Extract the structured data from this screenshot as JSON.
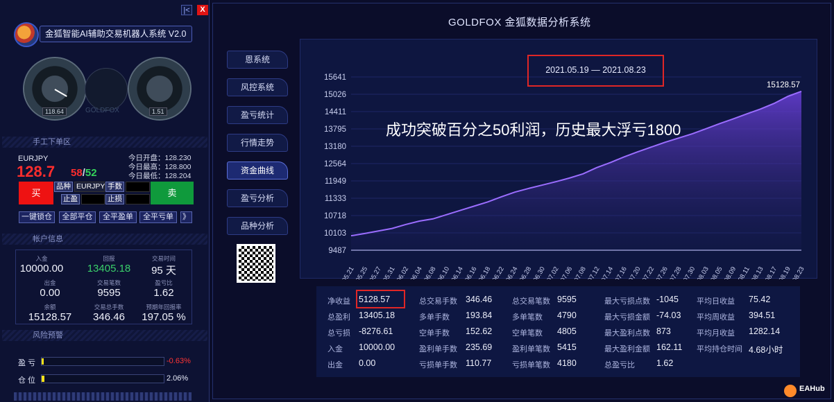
{
  "left": {
    "title": "金狐智能AI辅助交易机器人系统 V2.0",
    "window": {
      "collapse": "|<",
      "close": "X"
    },
    "gauges": {
      "g1_value": "118.64",
      "g2_value": "1.51",
      "watermark": "GOLDFOX"
    },
    "manual": {
      "header": "手工下单区",
      "symbol": "EURJPY",
      "price": "128.7",
      "pip_a": "58",
      "sep": "/",
      "pip_b": "52",
      "open_label": "今日开盘：128.230",
      "high_label": "今日最高：128.800",
      "low_label": "今日最低：128.204",
      "buy": "买",
      "sell": "卖",
      "product_label": "品种",
      "product_value": "EURJPY",
      "lots_label": "手数",
      "tp_label": "止盈",
      "sl_label": "止损",
      "buttons": [
        "一键锁仓",
        "全部平仓",
        "全平盈单",
        "全平亏单",
        "》"
      ]
    },
    "account": {
      "header": "帐户信息",
      "cells": [
        {
          "label": "入金",
          "value": "10000.00"
        },
        {
          "label": "回报",
          "value": "13405.18"
        },
        {
          "label": "交易时间",
          "value": "95 天"
        },
        {
          "label": "出金",
          "value": "0.00"
        },
        {
          "label": "交易笔数",
          "value": "9595"
        },
        {
          "label": "盈亏比",
          "value": "1.62"
        },
        {
          "label": "余额",
          "value": "15128.57"
        },
        {
          "label": "交易总手数",
          "value": "346.46"
        },
        {
          "label": "预期年回报率",
          "value": "197.05 %"
        }
      ]
    },
    "risk": {
      "header": "风险预警",
      "rows": [
        {
          "label": "盈 亏",
          "pct": "-0.63%",
          "level": 0.0063
        },
        {
          "label": "仓 位",
          "pct": "2.06%",
          "level": 0.0206
        }
      ]
    }
  },
  "main": {
    "title": "GOLDFOX 金狐数据分析系统",
    "nav": [
      "恩系统",
      "风控系统",
      "盈亏统计",
      "行情走势",
      "资金曲线",
      "盈亏分析",
      "品种分析"
    ],
    "date_range": "2021.05.19 — 2021.08.23",
    "overlay_text": "成功突破百分之50利润，历史最大浮亏1800",
    "colors": {
      "line": "#9b6dff",
      "red_box": "#e02626",
      "buy": "#ee1212",
      "sell": "#0f9a3c"
    }
  },
  "chart_data": {
    "type": "area",
    "yticks": [
      "15641",
      "15026",
      "14411",
      "13795",
      "13180",
      "12564",
      "11949",
      "11333",
      "10718",
      "10103",
      "9487"
    ],
    "ylim": [
      9487,
      15641
    ],
    "x": [
      "05.21",
      "05.25",
      "05.27",
      "05.31",
      "06.02",
      "06.04",
      "06.08",
      "06.10",
      "06.14",
      "06.16",
      "06.18",
      "06.22",
      "06.24",
      "06.28",
      "06.30",
      "07.02",
      "07.06",
      "07.08",
      "07.12",
      "07.14",
      "07.16",
      "07.20",
      "07.22",
      "07.26",
      "07.28",
      "07.30",
      "08.03",
      "08.05",
      "08.09",
      "08.11",
      "08.13",
      "08.17",
      "08.19",
      "08.23"
    ],
    "series": [
      {
        "values": [
          10000,
          10080,
          10170,
          10260,
          10400,
          10520,
          10600,
          10750,
          10900,
          11050,
          11200,
          11380,
          11550,
          11680,
          11800,
          11920,
          12050,
          12200,
          12420,
          12600,
          12800,
          12980,
          13150,
          13320,
          13470,
          13620,
          13800,
          13980,
          14150,
          14330,
          14500,
          14700,
          14950,
          15128.57
        ]
      }
    ],
    "end_label": "15128.57"
  },
  "stats": [
    [
      {
        "label": "净收益",
        "value": "5128.57"
      },
      {
        "label": "总盈利",
        "value": "13405.18"
      },
      {
        "label": "总亏损",
        "value": "-8276.61"
      },
      {
        "label": "入金",
        "value": "10000.00"
      },
      {
        "label": "出金",
        "value": "0.00"
      }
    ],
    [
      {
        "label": "总交易手数",
        "value": "346.46"
      },
      {
        "label": "多单手数",
        "value": "193.84"
      },
      {
        "label": "空单手数",
        "value": "152.62"
      },
      {
        "label": "盈利单手数",
        "value": "235.69"
      },
      {
        "label": "亏损单手数",
        "value": "110.77"
      }
    ],
    [
      {
        "label": "总交易笔数",
        "value": "9595"
      },
      {
        "label": "多单笔数",
        "value": "4790"
      },
      {
        "label": "空单笔数",
        "value": "4805"
      },
      {
        "label": "盈利单笔数",
        "value": "5415"
      },
      {
        "label": "亏损单笔数",
        "value": "4180"
      }
    ],
    [
      {
        "label": "最大亏损点数",
        "value": "-1045"
      },
      {
        "label": "最大亏损金额",
        "value": "-74.03"
      },
      {
        "label": "最大盈利点数",
        "value": "873"
      },
      {
        "label": "最大盈利金额",
        "value": "162.11"
      },
      {
        "label": "总盈亏比",
        "value": "1.62"
      }
    ],
    [
      {
        "label": "平均日收益",
        "value": "75.42"
      },
      {
        "label": "平均周收益",
        "value": "394.51"
      },
      {
        "label": "平均月收益",
        "value": "1282.14"
      },
      {
        "label": "平均持仓时间",
        "value": "4.68小时"
      }
    ]
  ],
  "footer": {
    "brand": "EAHub"
  }
}
